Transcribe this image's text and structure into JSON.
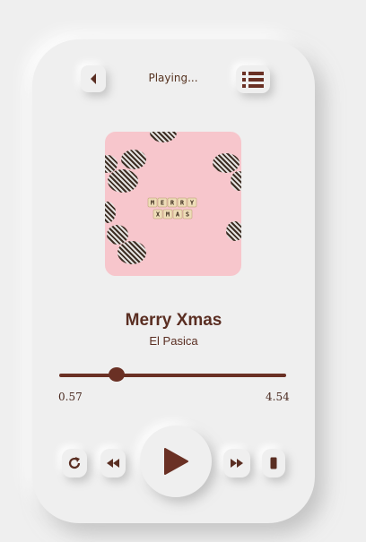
{
  "header": {
    "title": "Playing..."
  },
  "song": {
    "title": "Merry Xmas",
    "artist": "El Pasica"
  },
  "artwork": {
    "line1": "MERRY",
    "line2": "XMAS"
  },
  "player": {
    "current_time": "0.57",
    "total_time": "4.54",
    "progress_fraction": 0.25
  },
  "colors": {
    "accent": "#6a3024",
    "background": "#efefef",
    "artwork_bg": "#f7c6cc"
  },
  "icons": {
    "back": "back-icon",
    "list": "list-icon",
    "repeat": "repeat-icon",
    "rewind": "rewind-icon",
    "play": "play-icon",
    "fast_forward": "fast-forward-icon",
    "device": "device-icon"
  }
}
